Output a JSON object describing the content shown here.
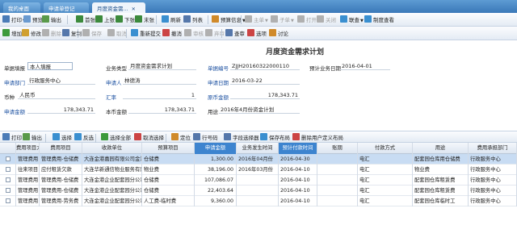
{
  "tabs": [
    {
      "label": "我的桌面",
      "active": false
    },
    {
      "label": "申请单登记",
      "active": false
    },
    {
      "label": "月度资金需...",
      "active": true
    }
  ],
  "toolbar1": [
    {
      "name": "print-button",
      "icon": "printer-icon",
      "label": "打印",
      "caret": true,
      "disabled": false,
      "color": "#4a7bb7"
    },
    {
      "name": "preview-button",
      "icon": "preview-icon",
      "label": "预览",
      "disabled": false,
      "color": "#6a9ad0"
    },
    {
      "name": "export-button",
      "icon": "export-icon",
      "label": "输出",
      "disabled": false,
      "color": "#5a9a4a"
    },
    {
      "name": "first-button",
      "icon": "first-page-icon",
      "label": "首张",
      "disabled": false,
      "color": "#3c8a3c"
    },
    {
      "name": "prev-button",
      "icon": "prev-page-icon",
      "label": "上张",
      "disabled": false,
      "color": "#3c8a3c"
    },
    {
      "name": "next-button",
      "icon": "next-page-icon",
      "label": "下张",
      "disabled": false,
      "color": "#3c8a3c"
    },
    {
      "name": "last-button",
      "icon": "last-page-icon",
      "label": "末张",
      "disabled": false,
      "color": "#3c8a3c"
    },
    {
      "name": "refresh-button",
      "icon": "refresh-icon",
      "label": "刷新",
      "disabled": false,
      "color": "#3a8fd0"
    },
    {
      "name": "list-button",
      "icon": "list-icon",
      "label": "列表",
      "disabled": false,
      "color": "#5577aa"
    },
    {
      "name": "budget-button",
      "icon": "budget-icon",
      "label": "预算信息",
      "caret": true,
      "disabled": false,
      "color": "#d08a2a"
    },
    {
      "name": "main-button",
      "icon": "main-icon",
      "label": "主单",
      "caret": true,
      "disabled": true,
      "color": "#b0b0b0"
    },
    {
      "name": "sub-button",
      "icon": "sub-icon",
      "label": "子单",
      "caret": true,
      "disabled": true,
      "color": "#b0b0b0"
    },
    {
      "name": "open-button",
      "icon": "open-icon",
      "label": "打开",
      "disabled": true,
      "color": "#b0b0b0"
    },
    {
      "name": "close-doc-button",
      "icon": "close-icon",
      "label": "关闭",
      "disabled": true,
      "color": "#b0b0b0"
    },
    {
      "name": "link-button",
      "icon": "link-icon",
      "label": "联查",
      "caret": true,
      "disabled": false,
      "color": "#3a8fd0"
    },
    {
      "name": "make-query-button",
      "icon": "query-icon",
      "label": "制度查看",
      "disabled": false,
      "color": "#3a8fd0"
    }
  ],
  "toolbar2": [
    {
      "name": "add-button",
      "icon": "add-icon",
      "label": "增加",
      "disabled": false,
      "color": "#3c9a3c"
    },
    {
      "name": "modify-button",
      "icon": "edit-icon",
      "label": "修改",
      "disabled": false,
      "color": "#d0a030"
    },
    {
      "name": "delete-button",
      "icon": "delete-icon",
      "label": "删除",
      "disabled": true,
      "color": "#b0b0b0"
    },
    {
      "name": "copy-button",
      "icon": "copy-icon",
      "label": "复制",
      "disabled": false,
      "color": "#5577aa"
    },
    {
      "name": "save-button",
      "icon": "save-icon",
      "label": "保存",
      "disabled": true,
      "color": "#b0b0b0"
    },
    {
      "name": "cancel-button",
      "icon": "cancel-icon",
      "label": "取消",
      "disabled": true,
      "color": "#b0b0b0"
    },
    {
      "name": "resubmit-button",
      "icon": "resubmit-icon",
      "label": "重新提交",
      "disabled": false,
      "color": "#3a8fd0"
    },
    {
      "name": "withdraw-button",
      "icon": "withdraw-icon",
      "label": "撤消",
      "disabled": false,
      "color": "#cc4444"
    },
    {
      "name": "audit-button",
      "icon": "audit-icon",
      "label": "审核",
      "disabled": true,
      "color": "#b0b0b0"
    },
    {
      "name": "unaudit-button",
      "icon": "unaudit-icon",
      "label": "弃审",
      "disabled": true,
      "color": "#b0b0b0"
    },
    {
      "name": "review-button",
      "icon": "review-icon",
      "label": "查审",
      "disabled": false,
      "color": "#5577aa"
    },
    {
      "name": "options-button",
      "icon": "options-icon",
      "label": "选项",
      "disabled": false,
      "color": "#cc4444"
    },
    {
      "name": "discuss-button",
      "icon": "discuss-icon",
      "label": "讨论",
      "disabled": false,
      "color": "#d08a2a"
    }
  ],
  "form": {
    "title": "月度资金需求计划",
    "fields": {
      "maker_label": "单据填报",
      "maker_value": "本人填报",
      "biztype_label": "业务类型",
      "biztype_value": "月度资金需求计划",
      "docno_label": "单据编号",
      "docno_value": "ZJJH20160322000110",
      "plandate_label": "预计业务日期",
      "plandate_value": "2016-04-01",
      "dept_label": "申请部门",
      "dept_value": "行政服务中心",
      "applicant_label": "申请人",
      "applicant_value": "林德涛",
      "appdate_label": "申请日期",
      "appdate_value": "2016-03-22",
      "currency_label": "币种",
      "currency_value": "人民币",
      "rate_label": "汇率",
      "rate_value": "1",
      "origamt_label": "原币金额",
      "origamt_value": "178,343.71",
      "amount_label": "申请金额",
      "amount_value": "178,343.71",
      "localamt_label": "本币金额",
      "localamt_value": "178,343.71",
      "purpose_label": "用途",
      "purpose_value": "2016年4月份资金计划"
    }
  },
  "gridtoolbar": [
    {
      "name": "grid-print-button",
      "icon": "printer-icon",
      "label": "打印",
      "color": "#4a7bb7"
    },
    {
      "name": "grid-export-button",
      "icon": "export-icon",
      "label": "输出",
      "color": "#5a9a4a"
    },
    {
      "name": "grid-select-button",
      "icon": "select-icon",
      "label": "选择",
      "color": "#3a8fd0"
    },
    {
      "name": "grid-invert-button",
      "icon": "invert-icon",
      "label": "反选",
      "color": "#3a8fd0"
    },
    {
      "name": "grid-select-all-button",
      "icon": "select-all-icon",
      "label": "选择全部",
      "color": "#3c9a3c"
    },
    {
      "name": "grid-unselect-button",
      "icon": "unselect-icon",
      "label": "取消选择",
      "color": "#cc4444"
    },
    {
      "name": "grid-locate-button",
      "icon": "locate-icon",
      "label": "定位",
      "color": "#d08a2a"
    },
    {
      "name": "grid-rownum-button",
      "icon": "rownum-icon",
      "label": "行号码",
      "color": "#5577aa"
    },
    {
      "name": "grid-fields-button",
      "icon": "fields-icon",
      "label": "字段选择器",
      "color": "#5577aa"
    },
    {
      "name": "grid-save-layout-button",
      "icon": "save-layout-icon",
      "label": "保存布局",
      "color": "#3a8fd0"
    },
    {
      "name": "grid-delete-layout-button",
      "icon": "delete-layout-icon",
      "label": "删除用户定义布局",
      "color": "#cc4444"
    }
  ],
  "grid": {
    "columns": [
      "",
      "费用项目大类",
      "费用项目",
      "收款单位",
      "预算项目",
      "申请金额",
      "业务发生时间",
      "预计付款时间",
      "账期",
      "付款方式",
      "用途",
      "费用承担部门"
    ],
    "highlight": [
      5,
      7
    ],
    "rows": [
      [
        "",
        "管理费用",
        "管理费用-仓储费",
        "大连金港嘉园有限公司金港",
        "仓储费",
        "1,300.00",
        "2016年04月份",
        "2016-04-30",
        "",
        "电汇",
        "配套园仓库用仓储费",
        "行政服务中心"
      ],
      [
        "",
        "往来项目",
        "应付租赁欠款",
        "大连华新通信物业服务有限",
        "物业费",
        "38,196.00",
        "2016年03月份",
        "2016-04-10",
        "",
        "电汇",
        "物业费",
        "行政服务中心"
      ],
      [
        "",
        "管理费用",
        "管理费用-仓储费",
        "大连金港企业配套园分公司",
        "仓储费",
        "107,086.07",
        "",
        "2016-04-10",
        "",
        "电汇",
        "配套园仓库租赁费",
        "行政服务中心"
      ],
      [
        "",
        "管理费用",
        "管理费用-仓储费",
        "大连金港企业配套园分公司",
        "仓储费",
        "22,403.64",
        "",
        "2016-04-10",
        "",
        "电汇",
        "配套园仓库租赁费",
        "行政服务中心"
      ],
      [
        "",
        "管理费用",
        "管理费用-劳务费",
        "大连金港企业配套园分公司",
        "人工费-临时费",
        "9,360.00",
        "",
        "2016-04-10",
        "",
        "电汇",
        "配套园仓库临时工",
        "行政服务中心"
      ]
    ]
  }
}
